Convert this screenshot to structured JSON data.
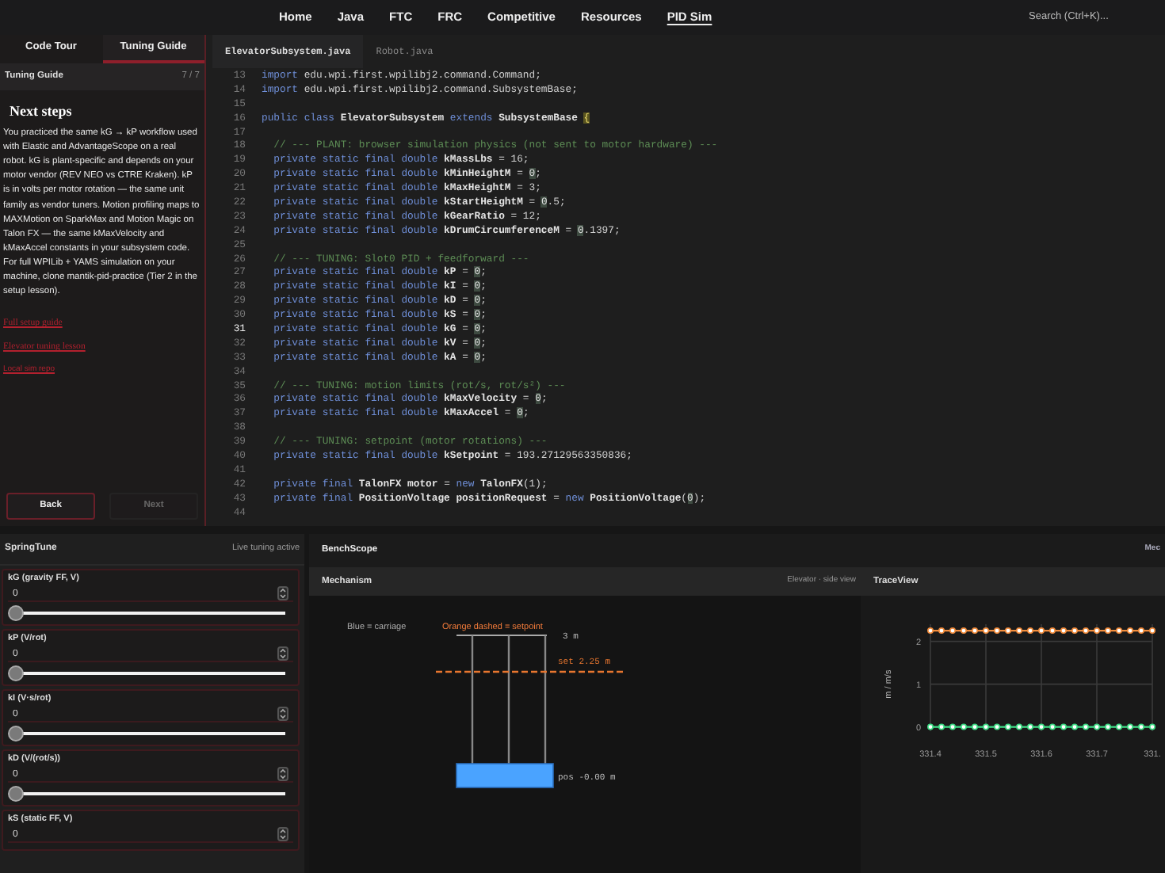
{
  "nav": {
    "links": [
      {
        "label": "Home",
        "selected": false
      },
      {
        "label": "Java",
        "selected": false
      },
      {
        "label": "FTC",
        "selected": false
      },
      {
        "label": "FRC",
        "selected": false
      },
      {
        "label": "Competitive",
        "selected": false
      },
      {
        "label": "Resources",
        "selected": false
      },
      {
        "label": "PID Sim",
        "selected": true
      }
    ],
    "search": {
      "placeholder": "Search (Ctrl+K)..."
    }
  },
  "guide": {
    "tabs": [
      {
        "label": "Code Tour",
        "selected": false
      },
      {
        "label": "Tuning Guide",
        "selected": true
      }
    ],
    "title": "Tuning Guide",
    "counter": "7 / 7",
    "heading": "Next steps",
    "body": "You practiced the same kG → kP workflow used with Elastic and AdvantageScope on a real robot. kG is plant-specific and depends on your motor vendor (REV NEO vs CTRE Kraken). kP is in volts per motor rotation — the same unit family as vendor tuners. Motion profiling maps to MAXMotion on SparkMax and Motion Magic on Talon FX — the same kMaxVelocity and kMaxAccel constants in your subsystem code. For full WPILib + YAMS simulation on your machine, clone mantik-pid-practice (Tier 2 in the setup lesson).",
    "links": [
      "Full setup guide",
      "Elevator tuning lesson",
      "Local sim repo"
    ],
    "buttons": [
      {
        "label": "Back",
        "disabled": false
      },
      {
        "label": "Next",
        "disabled": true
      }
    ]
  },
  "editor": {
    "tabs": [
      {
        "label": "ElevatorSubsystem.java",
        "selected": true
      },
      {
        "label": "Robot.java",
        "selected": false
      }
    ],
    "lines": [
      {
        "n": "13",
        "active": false,
        "segs": [
          {
            "kind": "kw",
            "text": "import"
          },
          {
            "kind": "tx",
            "text": " edu.wpi.first.wpilibj2.command.Command;"
          }
        ]
      },
      {
        "n": "14",
        "active": false,
        "segs": [
          {
            "kind": "kw",
            "text": "import"
          },
          {
            "kind": "tx",
            "text": " edu.wpi.first.wpilibj2.command.SubsystemBase;"
          }
        ]
      },
      {
        "n": "15",
        "active": false
      },
      {
        "n": "16",
        "active": false,
        "segs": [
          {
            "kind": "kw",
            "text": "public class"
          },
          {
            "kind": "id",
            "text": " ElevatorSubsystem "
          },
          {
            "kind": "kw",
            "text": "extends"
          },
          {
            "kind": "id",
            "text": " SubsystemBase "
          },
          {
            "kind": "br",
            "text": "{"
          }
        ]
      },
      {
        "n": "17",
        "active": false
      },
      {
        "n": "18",
        "active": false,
        "segs": [
          {
            "kind": "cm",
            "text": "  // --- PLANT: browser simulation physics (not sent to motor hardware) ---"
          }
        ]
      },
      {
        "n": "19",
        "active": false,
        "segs": [
          {
            "kind": "kw",
            "text": "  private static final double"
          },
          {
            "kind": "id",
            "text": " kMassLbs"
          },
          {
            "kind": "tx",
            "text": " = 16;"
          }
        ]
      },
      {
        "n": "20",
        "active": false,
        "segs": [
          {
            "kind": "kw",
            "text": "  private static final double"
          },
          {
            "kind": "id",
            "text": " kMinHeightM"
          },
          {
            "kind": "tx",
            "text": " = "
          },
          {
            "kind": "hl",
            "text": "0"
          },
          {
            "kind": "tx",
            "text": ";"
          }
        ]
      },
      {
        "n": "21",
        "active": false,
        "segs": [
          {
            "kind": "kw",
            "text": "  private static final double"
          },
          {
            "kind": "id",
            "text": " kMaxHeightM"
          },
          {
            "kind": "tx",
            "text": " = 3;"
          }
        ]
      },
      {
        "n": "22",
        "active": false,
        "segs": [
          {
            "kind": "kw",
            "text": "  private static final double"
          },
          {
            "kind": "id",
            "text": " kStartHeightM"
          },
          {
            "kind": "tx",
            "text": " = "
          },
          {
            "kind": "hl",
            "text": "0"
          },
          {
            "kind": "tx",
            "text": ".5;"
          }
        ]
      },
      {
        "n": "23",
        "active": false,
        "segs": [
          {
            "kind": "kw",
            "text": "  private static final double"
          },
          {
            "kind": "id",
            "text": " kGearRatio"
          },
          {
            "kind": "tx",
            "text": " = 12;"
          }
        ]
      },
      {
        "n": "24",
        "active": false,
        "segs": [
          {
            "kind": "kw",
            "text": "  private static final double"
          },
          {
            "kind": "id",
            "text": " kDrumCircumferenceM"
          },
          {
            "kind": "tx",
            "text": " = "
          },
          {
            "kind": "hl",
            "text": "0"
          },
          {
            "kind": "tx",
            "text": ".1397;"
          }
        ]
      },
      {
        "n": "25",
        "active": false
      },
      {
        "n": "26",
        "active": false,
        "segs": [
          {
            "kind": "cm",
            "text": "  // --- TUNING: Slot0 PID + feedforward ---"
          }
        ]
      },
      {
        "n": "27",
        "active": false,
        "segs": [
          {
            "kind": "kw",
            "text": "  private static final double"
          },
          {
            "kind": "id",
            "text": " kP"
          },
          {
            "kind": "tx",
            "text": " = "
          },
          {
            "kind": "hl",
            "text": "0"
          },
          {
            "kind": "tx",
            "text": ";"
          }
        ]
      },
      {
        "n": "28",
        "active": false,
        "segs": [
          {
            "kind": "kw",
            "text": "  private static final double"
          },
          {
            "kind": "id",
            "text": " kI"
          },
          {
            "kind": "tx",
            "text": " = "
          },
          {
            "kind": "hl",
            "text": "0"
          },
          {
            "kind": "tx",
            "text": ";"
          }
        ]
      },
      {
        "n": "29",
        "active": false,
        "segs": [
          {
            "kind": "kw",
            "text": "  private static final double"
          },
          {
            "kind": "id",
            "text": " kD"
          },
          {
            "kind": "tx",
            "text": " = "
          },
          {
            "kind": "hl",
            "text": "0"
          },
          {
            "kind": "tx",
            "text": ";"
          }
        ]
      },
      {
        "n": "30",
        "active": false,
        "segs": [
          {
            "kind": "kw",
            "text": "  private static final double"
          },
          {
            "kind": "id",
            "text": " kS"
          },
          {
            "kind": "tx",
            "text": " = "
          },
          {
            "kind": "hl",
            "text": "0"
          },
          {
            "kind": "tx",
            "text": ";"
          }
        ]
      },
      {
        "n": "31",
        "active": true,
        "segs": [
          {
            "kind": "kw",
            "text": "  private static final double"
          },
          {
            "kind": "id",
            "text": " kG"
          },
          {
            "kind": "tx",
            "text": " = "
          },
          {
            "kind": "hl",
            "text": "0"
          },
          {
            "kind": "tx",
            "text": ";"
          }
        ]
      },
      {
        "n": "32",
        "active": false,
        "segs": [
          {
            "kind": "kw",
            "text": "  private static final double"
          },
          {
            "kind": "id",
            "text": " kV"
          },
          {
            "kind": "tx",
            "text": " = "
          },
          {
            "kind": "hl",
            "text": "0"
          },
          {
            "kind": "tx",
            "text": ";"
          }
        ]
      },
      {
        "n": "33",
        "active": false,
        "segs": [
          {
            "kind": "kw",
            "text": "  private static final double"
          },
          {
            "kind": "id",
            "text": " kA"
          },
          {
            "kind": "tx",
            "text": " = "
          },
          {
            "kind": "hl",
            "text": "0"
          },
          {
            "kind": "tx",
            "text": ";"
          }
        ]
      },
      {
        "n": "34",
        "active": false
      },
      {
        "n": "35",
        "active": false,
        "segs": [
          {
            "kind": "cm",
            "text": "  // --- TUNING: motion limits (rot/s, rot/s²) ---"
          }
        ]
      },
      {
        "n": "36",
        "active": false,
        "segs": [
          {
            "kind": "kw",
            "text": "  private static final double"
          },
          {
            "kind": "id",
            "text": " kMaxVelocity"
          },
          {
            "kind": "tx",
            "text": " = "
          },
          {
            "kind": "hl",
            "text": "0"
          },
          {
            "kind": "tx",
            "text": ";"
          }
        ]
      },
      {
        "n": "37",
        "active": false,
        "segs": [
          {
            "kind": "kw",
            "text": "  private static final double"
          },
          {
            "kind": "id",
            "text": " kMaxAccel"
          },
          {
            "kind": "tx",
            "text": " = "
          },
          {
            "kind": "hl",
            "text": "0"
          },
          {
            "kind": "tx",
            "text": ";"
          }
        ]
      },
      {
        "n": "38",
        "active": false
      },
      {
        "n": "39",
        "active": false,
        "segs": [
          {
            "kind": "cm",
            "text": "  // --- TUNING: setpoint (motor rotations) ---"
          }
        ]
      },
      {
        "n": "40",
        "active": false,
        "segs": [
          {
            "kind": "kw",
            "text": "  private static final double"
          },
          {
            "kind": "id",
            "text": " kSetpoint"
          },
          {
            "kind": "tx",
            "text": " = 193.27129563350836;"
          }
        ]
      },
      {
        "n": "41",
        "active": false
      },
      {
        "n": "42",
        "active": false,
        "segs": [
          {
            "kind": "kw",
            "text": "  private final"
          },
          {
            "kind": "id",
            "text": " TalonFX motor"
          },
          {
            "kind": "tx",
            "text": " = "
          },
          {
            "kind": "kw",
            "text": "new"
          },
          {
            "kind": "id",
            "text": " TalonFX"
          },
          {
            "kind": "tx",
            "text": "(1);"
          }
        ]
      },
      {
        "n": "43",
        "active": false,
        "segs": [
          {
            "kind": "kw",
            "text": "  private final"
          },
          {
            "kind": "id",
            "text": " PositionVoltage positionRequest"
          },
          {
            "kind": "tx",
            "text": " = "
          },
          {
            "kind": "kw",
            "text": "new"
          },
          {
            "kind": "id",
            "text": " PositionVoltage"
          },
          {
            "kind": "tx",
            "text": "("
          },
          {
            "kind": "hl",
            "text": "0"
          },
          {
            "kind": "tx",
            "text": ");"
          }
        ]
      },
      {
        "n": "44",
        "active": false
      }
    ]
  },
  "springtune": {
    "title": "SpringTune",
    "status": "Live tuning active",
    "params": [
      {
        "label": "kG (gravity FF, V)",
        "value": "0",
        "level": 0
      },
      {
        "label": "kP (V/rot)",
        "value": "0",
        "level": 0
      },
      {
        "label": "kI (V·s/rot)",
        "value": "0",
        "level": 0
      },
      {
        "label": "kD (V/(rot/s))",
        "value": "0",
        "level": 0
      },
      {
        "label": "kS (static FF, V)",
        "value": "0"
      }
    ]
  },
  "benchscope": {
    "title": "BenchScope",
    "tab_cut": "Mec",
    "mechanism": {
      "title": "Mechanism",
      "subtitle": "Elevator · side view",
      "legend": [
        "Blue = carriage",
        "Orange dashed = setpoint"
      ],
      "top_label": "3 m",
      "setpoint_label": "set 2.25 m",
      "position_label": "pos -0.00 m"
    },
    "traceview": {
      "title": "TraceView",
      "cut_tick_label": "331.",
      "chart_data": {
        "type": "line",
        "ylabel": "m / m/s",
        "grid": true,
        "x": [
          331.4,
          331.42,
          331.44,
          331.46,
          331.48,
          331.5,
          331.52,
          331.54,
          331.56,
          331.58,
          331.6,
          331.62,
          331.64,
          331.66,
          331.68,
          331.7,
          331.72,
          331.74,
          331.76,
          331.78,
          331.8
        ],
        "series": [
          {
            "color": "#f28c3c",
            "marker": "circle",
            "values": [
              2.25,
              2.25,
              2.25,
              2.25,
              2.25,
              2.25,
              2.25,
              2.25,
              2.25,
              2.25,
              2.25,
              2.25,
              2.25,
              2.25,
              2.25,
              2.25,
              2.25,
              2.25,
              2.25,
              2.25,
              2.25
            ]
          },
          {
            "color": "#3ddc84",
            "marker": "circle",
            "values": [
              0,
              0,
              0,
              0,
              0,
              0,
              0,
              0,
              0,
              0,
              0,
              0,
              0,
              0,
              0,
              0,
              0,
              0,
              0,
              0,
              0
            ]
          }
        ],
        "xlim": [
          331.4,
          331.8
        ],
        "ylim": [
          -0.1,
          2.4
        ],
        "yticks": [
          0,
          1,
          2
        ],
        "xticks": [
          331.4,
          331.5,
          331.6,
          331.7
        ]
      }
    }
  }
}
